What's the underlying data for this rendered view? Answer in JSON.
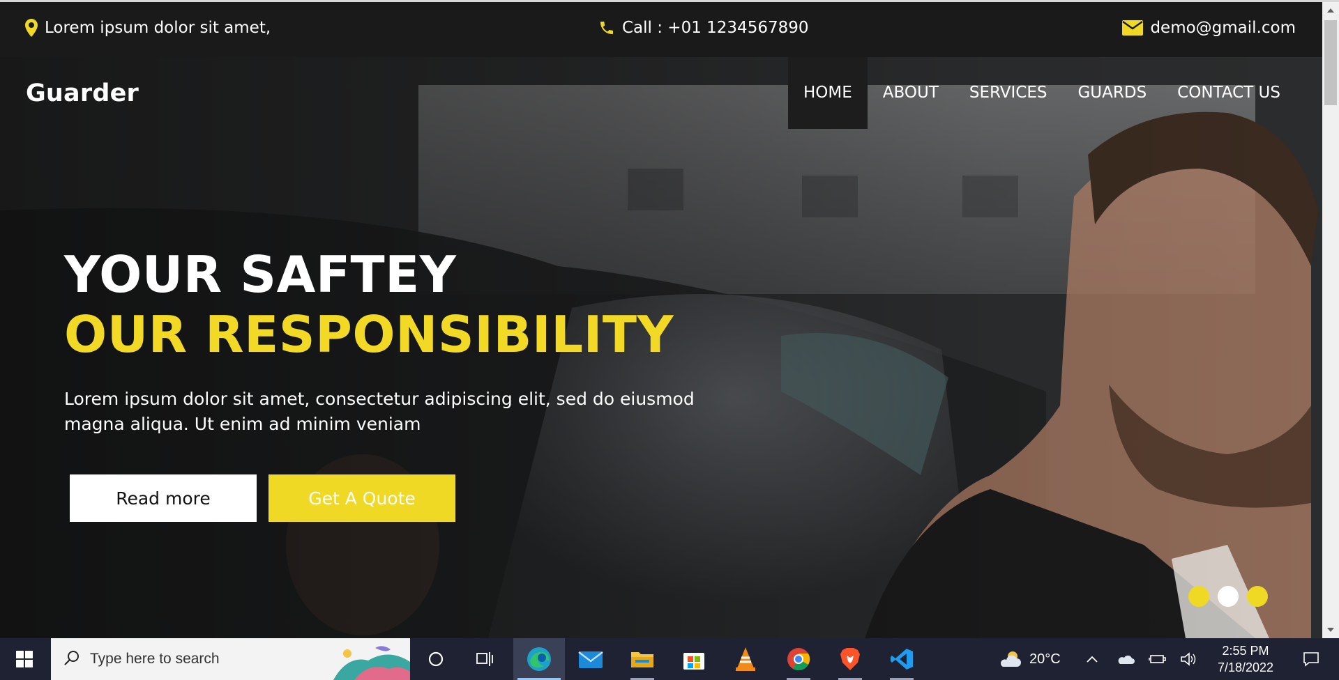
{
  "topbar": {
    "location": "Lorem ipsum dolor sit amet,",
    "call": "Call : +01 1234567890",
    "email": "demo@gmail.com"
  },
  "header": {
    "brand": "Guarder",
    "nav": [
      "HOME",
      "ABOUT",
      "SERVICES",
      "GUARDS",
      "CONTACT US"
    ],
    "active_nav": "HOME"
  },
  "hero": {
    "headline_1": "YOUR SAFTEY",
    "headline_2": "OUR RESPONSIBILITY",
    "text": "Lorem ipsum dolor sit amet, consectetur adipiscing elit, sed do eiusmod magna aliqua. Ut enim ad minim veniam",
    "read_more": "Read more",
    "get_quote": "Get A Quote",
    "slides": 3,
    "active_slide": 2
  },
  "colors": {
    "accent": "#f0d924",
    "topbar_bg": "#1a1a1a",
    "taskbar_bg": "#1e2233"
  },
  "taskbar": {
    "search_placeholder": "Type here to search",
    "apps": [
      "cortana-icon",
      "task-view-icon",
      "edge-icon",
      "mail-icon",
      "file-explorer-icon",
      "store-icon",
      "vlc-icon",
      "chrome-icon",
      "brave-icon",
      "vscode-icon"
    ],
    "weather": "20°C",
    "time": "2:55 PM",
    "date": "7/18/2022"
  }
}
